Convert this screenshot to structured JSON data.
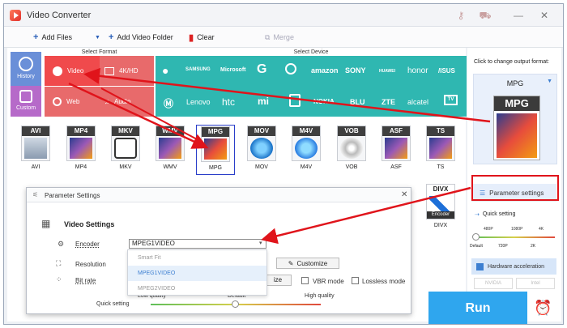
{
  "window": {
    "title": "Video Converter",
    "minimize": "—",
    "close": "✕"
  },
  "toolbar": {
    "add_files": "Add Files",
    "add_folder": "Add Video Folder",
    "clear": "Clear",
    "merge": "Merge"
  },
  "format_panel": {
    "select_format": "Select Format",
    "select_device": "Select Device",
    "history": "History",
    "custom": "Custom",
    "categories": [
      "Video",
      "4K/HD",
      "Web",
      "Audio"
    ],
    "devices_row1": [
      "",
      "SAMSUNG",
      "Microsoft",
      "G",
      "",
      "amazon",
      "SONY",
      "HUAWEI",
      "honor",
      "/ISUS"
    ],
    "devices_row2": [
      "",
      "Lenovo",
      "htc",
      "mi",
      "",
      "NOKIA",
      "BLU",
      "ZTE",
      "alcatel",
      "TV"
    ],
    "video_formats": [
      "AVI",
      "MP4",
      "MKV",
      "WMV",
      "MPG",
      "MOV",
      "M4V",
      "VOB",
      "ASF",
      "TS"
    ],
    "divx": "DIVX",
    "divx_sub": "Encoder"
  },
  "right_panel": {
    "hint": "Click to change output format:",
    "format_name": "MPG",
    "param_button": "Parameter settings",
    "quick_setting": "Quick setting",
    "res_top": [
      "480P",
      "1080P",
      "4K"
    ],
    "res_bottom": [
      "Default",
      "720P",
      "2K"
    ],
    "hw_accel": "Hardware acceleration",
    "gpu1": "NVIDIA",
    "gpu2": "Intel",
    "run": "Run"
  },
  "dialog": {
    "title": "Parameter Settings",
    "section": "Video Settings",
    "encoder_label": "Encoder",
    "encoder_value": "MPEG1VIDEO",
    "resolution_label": "Resolution",
    "customize": "Customize",
    "bitrate_label": "Bit rate",
    "bitrate_partial": "ize",
    "vbr": "VBR mode",
    "lossless": "Lossless mode",
    "options": [
      "Smart Fit",
      "MPEG1VIDEO",
      "MPEG2VIDEO"
    ],
    "quality_low": "Low quality",
    "quality_default": "Default",
    "quality_high": "High quality",
    "quick_setting": "Quick setting"
  }
}
